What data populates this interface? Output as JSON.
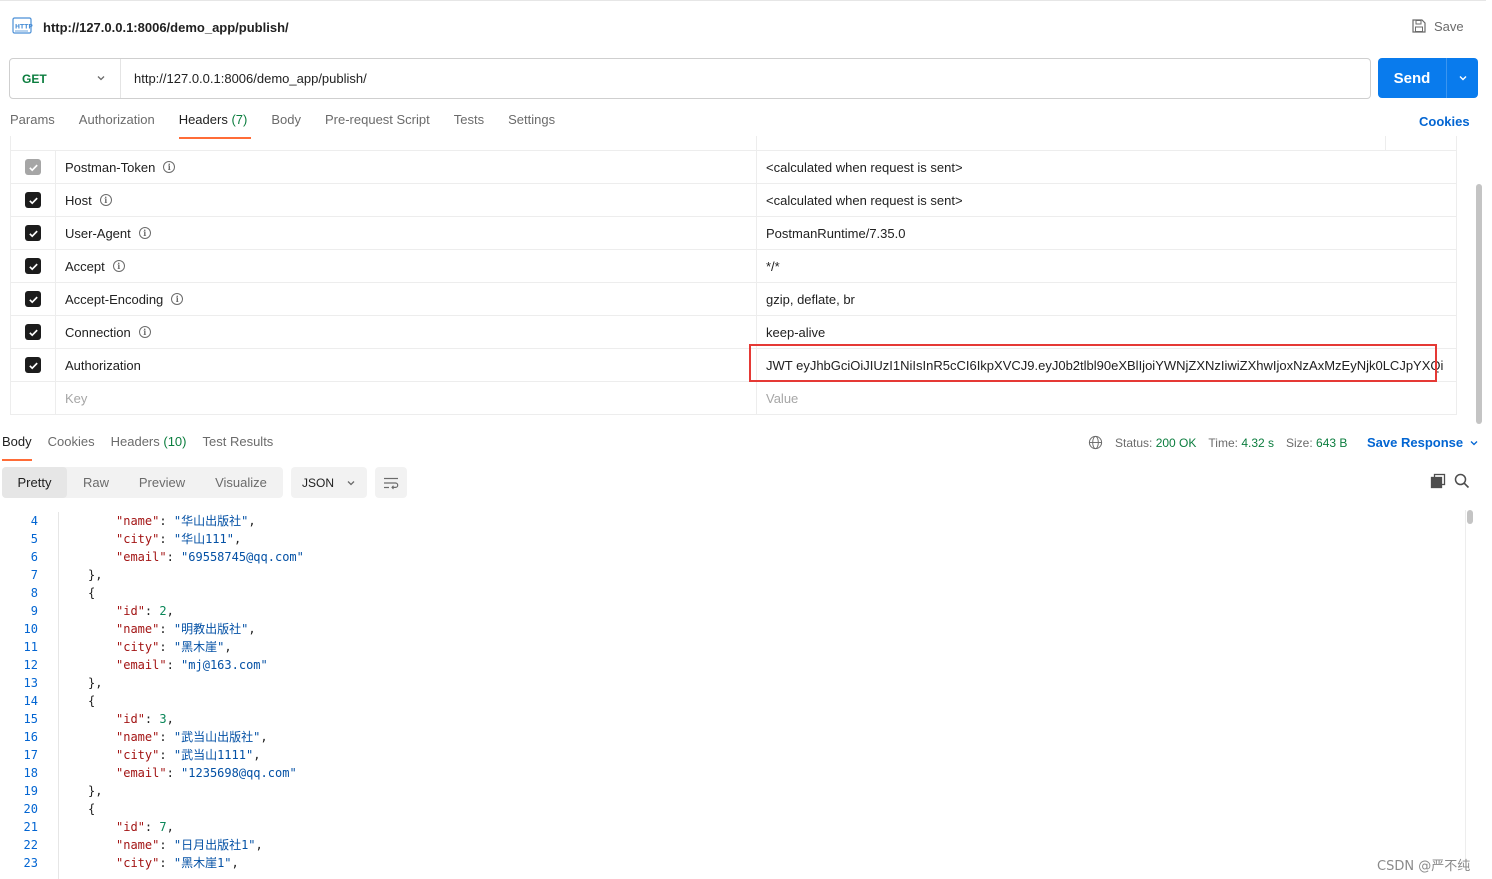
{
  "window": {
    "title_url": "http://127.0.0.1:8006/demo_app/publish/",
    "save_label": "Save"
  },
  "request": {
    "method": "GET",
    "url": "http://127.0.0.1:8006/demo_app/publish/",
    "send_label": "Send"
  },
  "request_tabs": [
    {
      "label": "Params"
    },
    {
      "label": "Authorization"
    },
    {
      "label": "Headers",
      "count": "(7)",
      "active": true
    },
    {
      "label": "Body"
    },
    {
      "label": "Pre-request Script"
    },
    {
      "label": "Tests"
    },
    {
      "label": "Settings"
    }
  ],
  "cookies_label": "Cookies",
  "headers": [
    {
      "key": "Postman-Token",
      "value": "<calculated when request is sent>",
      "checked": true,
      "disabled": true,
      "info": true
    },
    {
      "key": "Host",
      "value": "<calculated when request is sent>",
      "checked": true,
      "disabled": false,
      "info": true
    },
    {
      "key": "User-Agent",
      "value": "PostmanRuntime/7.35.0",
      "checked": true,
      "disabled": false,
      "info": true
    },
    {
      "key": "Accept",
      "value": "*/*",
      "checked": true,
      "disabled": false,
      "info": true
    },
    {
      "key": "Accept-Encoding",
      "value": "gzip, deflate, br",
      "checked": true,
      "disabled": false,
      "info": true
    },
    {
      "key": "Connection",
      "value": "keep-alive",
      "checked": true,
      "disabled": false,
      "info": true
    },
    {
      "key": "Authorization",
      "value": "JWT eyJhbGciOiJIUzI1NiIsInR5cCI6IkpXVCJ9.eyJ0b2tlbl90eXBlIjoiYWNjZXNzIiwiZXhwIjoxNzAxMzEyNjk0LCJpYXQi",
      "checked": true,
      "disabled": false,
      "info": false
    }
  ],
  "new_header": {
    "key_placeholder": "Key",
    "value_placeholder": "Value"
  },
  "response_tabs": [
    {
      "label": "Body",
      "active": true
    },
    {
      "label": "Cookies"
    },
    {
      "label": "Headers",
      "count": "(10)"
    },
    {
      "label": "Test Results"
    }
  ],
  "response_meta": {
    "status_label": "Status:",
    "status_value": "200 OK",
    "time_label": "Time:",
    "time_value": "4.32 s",
    "size_label": "Size:",
    "size_value": "643 B",
    "save_response_label": "Save Response"
  },
  "view_modes": [
    "Pretty",
    "Raw",
    "Preview",
    "Visualize"
  ],
  "format": "JSON",
  "code_lines": [
    {
      "n": "4",
      "indent": 2,
      "key": "name",
      "str": "华山出版社",
      "end": ","
    },
    {
      "n": "5",
      "indent": 2,
      "key": "city",
      "str": "华山111",
      "end": ","
    },
    {
      "n": "6",
      "indent": 2,
      "key": "email",
      "str": "69558745@qq.com",
      "end": ""
    },
    {
      "n": "7",
      "indent": 1,
      "raw": "},"
    },
    {
      "n": "8",
      "indent": 1,
      "raw": "{"
    },
    {
      "n": "9",
      "indent": 2,
      "key": "id",
      "num": "2",
      "end": ","
    },
    {
      "n": "10",
      "indent": 2,
      "key": "name",
      "str": "明教出版社",
      "end": ","
    },
    {
      "n": "11",
      "indent": 2,
      "key": "city",
      "str": "黑木崖",
      "end": ","
    },
    {
      "n": "12",
      "indent": 2,
      "key": "email",
      "str": "mj@163.com",
      "end": ""
    },
    {
      "n": "13",
      "indent": 1,
      "raw": "},"
    },
    {
      "n": "14",
      "indent": 1,
      "raw": "{"
    },
    {
      "n": "15",
      "indent": 2,
      "key": "id",
      "num": "3",
      "end": ","
    },
    {
      "n": "16",
      "indent": 2,
      "key": "name",
      "str": "武当山出版社",
      "end": ","
    },
    {
      "n": "17",
      "indent": 2,
      "key": "city",
      "str": "武当山1111",
      "end": ","
    },
    {
      "n": "18",
      "indent": 2,
      "key": "email",
      "str": "1235698@qq.com",
      "end": ""
    },
    {
      "n": "19",
      "indent": 1,
      "raw": "},"
    },
    {
      "n": "20",
      "indent": 1,
      "raw": "{"
    },
    {
      "n": "21",
      "indent": 2,
      "key": "id",
      "num": "7",
      "end": ","
    },
    {
      "n": "22",
      "indent": 2,
      "key": "name",
      "str": "日月出版社1",
      "end": ","
    },
    {
      "n": "23",
      "indent": 2,
      "key": "city",
      "str": "黑木崖1",
      "end": ","
    }
  ],
  "watermark": "CSDN @严不纯"
}
